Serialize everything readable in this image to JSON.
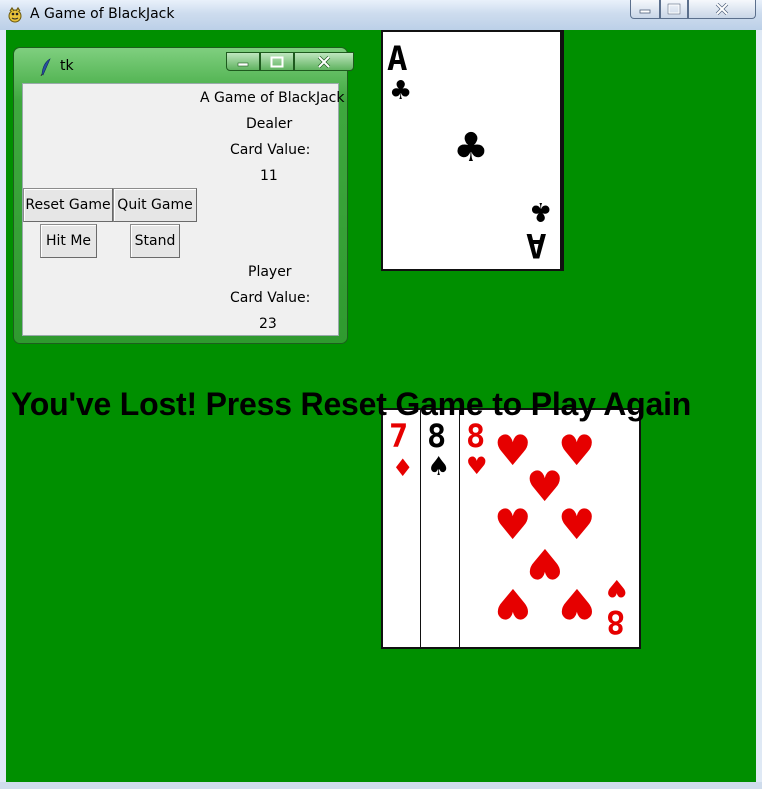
{
  "window": {
    "title": "A Game of BlackJack",
    "background_color": "#008f00"
  },
  "tk_window": {
    "title": "tk",
    "heading": "A Game of BlackJack",
    "dealer_label": "Dealer",
    "dealer_value_label": "Card Value:",
    "dealer_value": "11",
    "reset_button": "Reset Game",
    "quit_button": "Quit Game",
    "hit_button": "Hit Me",
    "stand_button": "Stand",
    "player_label": "Player",
    "player_value_label": "Card Value:",
    "player_value": "23"
  },
  "message": "You've Lost! Press Reset Game to Play Again",
  "dealer_cards": [
    {
      "rank": "A",
      "suit": "♣",
      "color": "#000000"
    }
  ],
  "player_cards": [
    {
      "rank": "7",
      "suit": "♦",
      "color": "#e60000"
    },
    {
      "rank": "8",
      "suit": "♠",
      "color": "#000000"
    },
    {
      "rank": "8",
      "suit": "♥",
      "color": "#e60000"
    }
  ]
}
